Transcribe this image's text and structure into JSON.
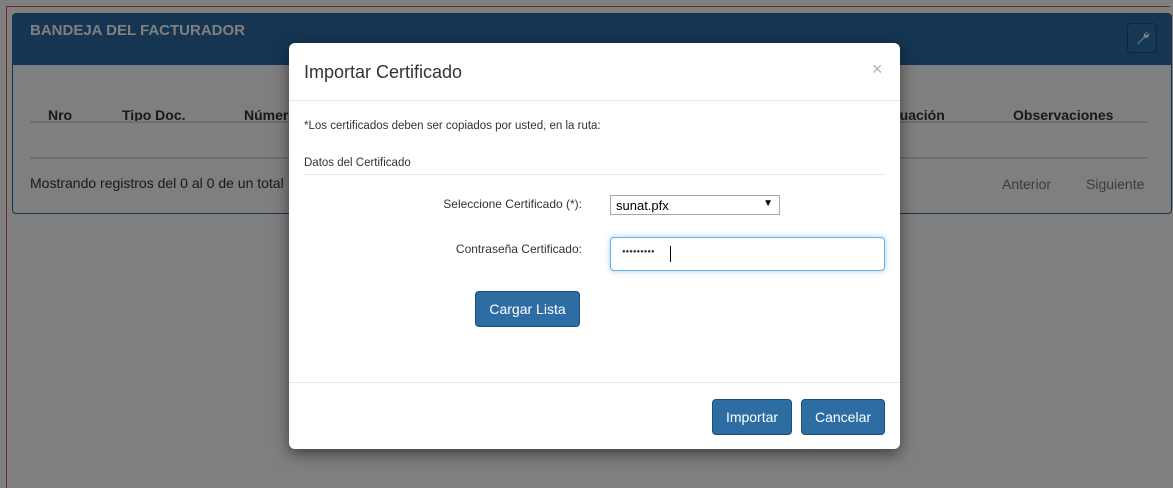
{
  "panel": {
    "title": "BANDEJA DEL FACTURADOR",
    "columns": [
      "Nro",
      "Tipo Doc.",
      "Númer",
      "tuación",
      "Observaciones"
    ],
    "footer_text": "Mostrando registros del 0 al 0 de un total",
    "pager": {
      "previous": "Anterior",
      "next": "Siguiente"
    },
    "tool_icon": "wrench-icon"
  },
  "modal": {
    "title": "Importar Certificado",
    "close_icon": "×",
    "note": "*Los certificados deben ser copiados por usted, en la ruta:",
    "section_legend": "Datos del Certificado",
    "certificate_label": "Seleccione Certificado (*):",
    "certificate_selected": "sunat.pfx",
    "password_label": "Contraseña Certificado:",
    "password_mask": "●●●●●●●●●",
    "load_button": "Cargar Lista",
    "import_button": "Importar",
    "cancel_button": "Cancelar"
  },
  "colors": {
    "header_blue": "#2a6aa6",
    "button_blue": "#2e6da4",
    "frame_red": "#d9534f"
  }
}
